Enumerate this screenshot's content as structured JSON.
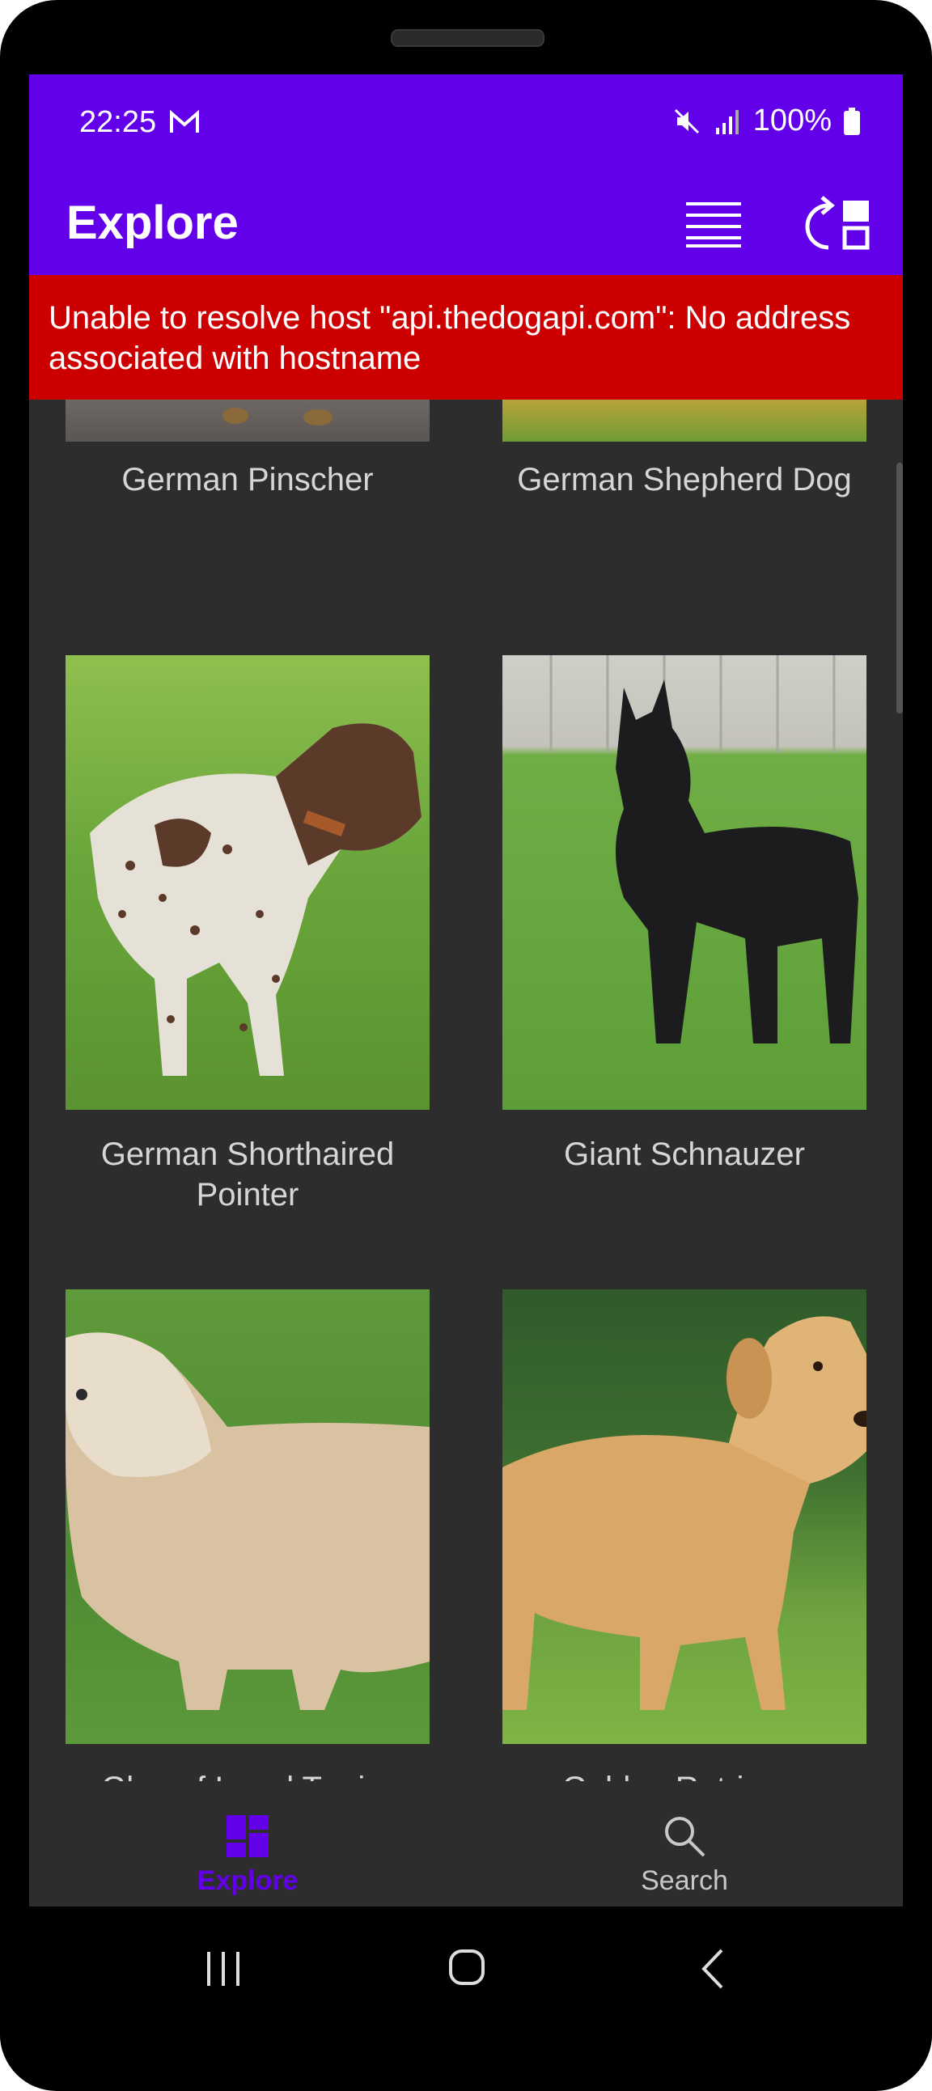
{
  "status": {
    "time": "22:25",
    "battery": "100%"
  },
  "appbar": {
    "title": "Explore"
  },
  "error": {
    "message": "Unable to resolve host \"api.thedogapi.com\": No address associated with hostname"
  },
  "breeds": [
    {
      "name": "German Pinscher"
    },
    {
      "name": "German Shepherd Dog"
    },
    {
      "name": "German Shorthaired Pointer"
    },
    {
      "name": "Giant Schnauzer"
    },
    {
      "name": "Glen of Imaal Terrier"
    },
    {
      "name": "Golden Retriever"
    }
  ],
  "bottom_nav": {
    "explore_label": "Explore",
    "search_label": "Search",
    "active": "Explore"
  },
  "colors": {
    "primary": "#6200ea",
    "error": "#cc0000",
    "background": "#2d2d2d"
  }
}
